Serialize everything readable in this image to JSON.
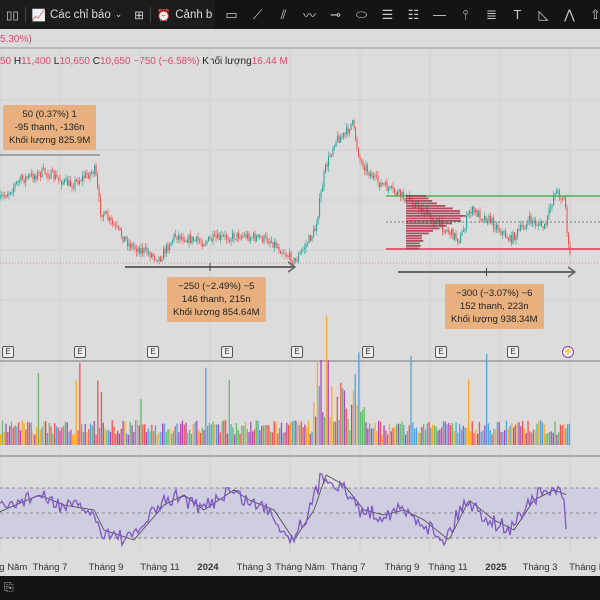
{
  "toolbar": {
    "indicators_label": "Các chỉ báo",
    "alert_label": "Cảnh b"
  },
  "header": {
    "change_partial": "5.30%)"
  },
  "legend": {
    "open_partial": "50",
    "h_label": "H",
    "high": "11,400",
    "l_label": "L",
    "low": "10,650",
    "c_label": "C",
    "close": "10,650",
    "change": "−750 (−6.58%)",
    "volume_label": "Khối lượng",
    "volume": "16.44 M"
  },
  "measures": [
    {
      "line1": "50 (0.37%) 1",
      "line2": "-95 thanh, -136n",
      "line3": "Khối lượng 825.9M"
    },
    {
      "line1": "−250 (−2.49%) −5",
      "line2": "146 thanh, 215n",
      "line3": "Khối lượng 854.64M"
    },
    {
      "line1": "−300 (−3.07%) −6",
      "line2": "152 thanh, 223n",
      "line3": "Khối lượng 938.34M"
    }
  ],
  "earnings_marker": "E",
  "time_axis": [
    "áng Năm",
    "Tháng 7",
    "Tháng 9",
    "Tháng 11",
    "2024",
    "Tháng 3",
    "Tháng Năm",
    "Tháng 7",
    "Tháng 9",
    "Tháng 11",
    "2025",
    "Tháng 3",
    "Tháng Nă"
  ],
  "colors": {
    "up": "#26a69a",
    "down": "#ef5350",
    "support": "#e8344e",
    "resistance": "#4caf50",
    "rsi": "#7e57c2"
  }
}
